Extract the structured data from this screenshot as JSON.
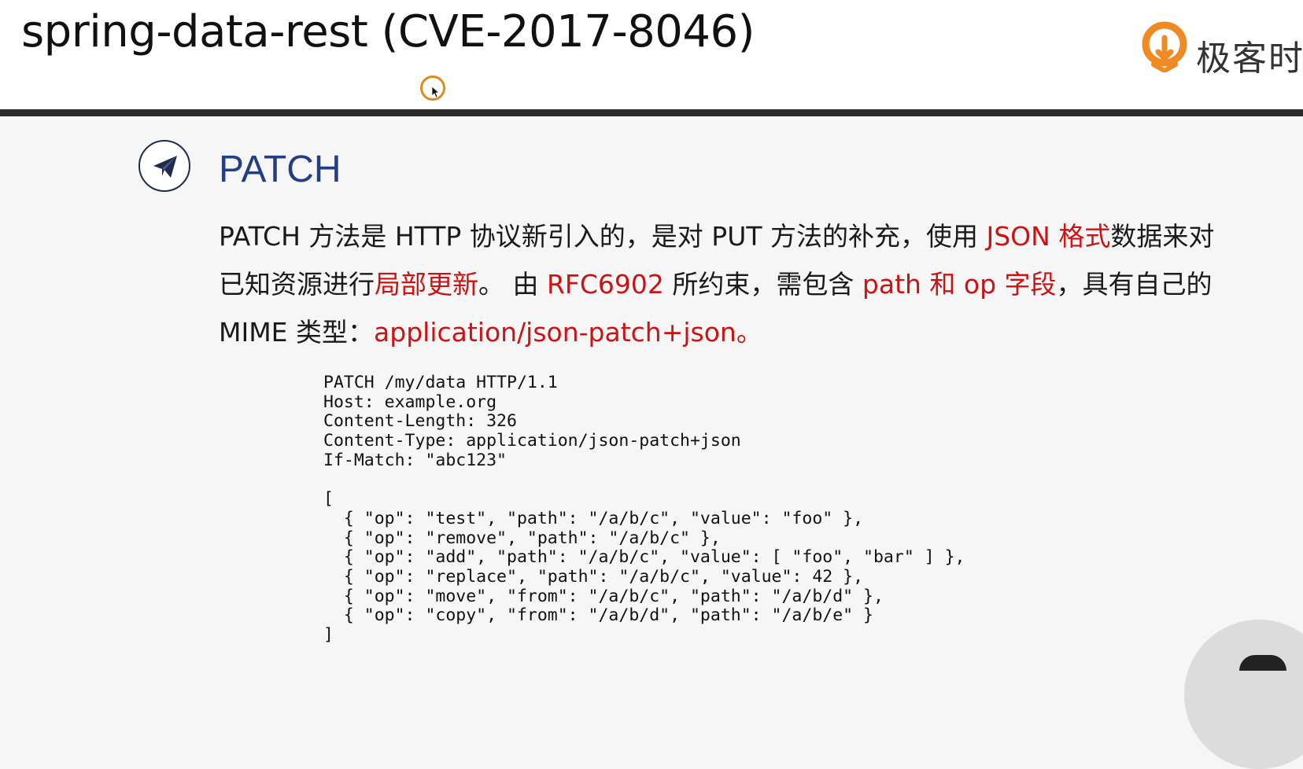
{
  "slide": {
    "title": "spring-data-rest (CVE-2017-8046)",
    "brand": "极客时",
    "section_title": "PATCH",
    "paragraph": {
      "l1a": "PATCH 方法是 HTTP 协议新引入的，是对 PUT 方法的补充，使用 ",
      "l1b": "JSON 格式",
      "l1c": "数据来对",
      "l2a": "已知资源进行",
      "l2b": "局部更新",
      "l2c": "。 由 ",
      "l2d": "RFC6902",
      "l2e": " 所约束，需包含 ",
      "l2f": "path 和 op 字段",
      "l2g": "，具有自己的",
      "l3a": "MIME 类型：",
      "l3b": "application/json-patch+json。"
    },
    "code": "PATCH /my/data HTTP/1.1\nHost: example.org\nContent-Length: 326\nContent-Type: application/json-patch+json\nIf-Match: \"abc123\"\n\n[\n  { \"op\": \"test\", \"path\": \"/a/b/c\", \"value\": \"foo\" },\n  { \"op\": \"remove\", \"path\": \"/a/b/c\" },\n  { \"op\": \"add\", \"path\": \"/a/b/c\", \"value\": [ \"foo\", \"bar\" ] },\n  { \"op\": \"replace\", \"path\": \"/a/b/c\", \"value\": 42 },\n  { \"op\": \"move\", \"from\": \"/a/b/c\", \"path\": \"/a/b/d\" },\n  { \"op\": \"copy\", \"from\": \"/a/b/d\", \"path\": \"/a/b/e\" }\n]"
  },
  "icons": {
    "section": "paper-plane-icon",
    "brand": "geekbang-logo-icon",
    "cursor": "mouse-cursor-icon"
  },
  "colors": {
    "highlight": "#cc1212",
    "section_title": "#243e86",
    "brand_orange": "#f08a24",
    "rule": "#2b2b2b"
  }
}
